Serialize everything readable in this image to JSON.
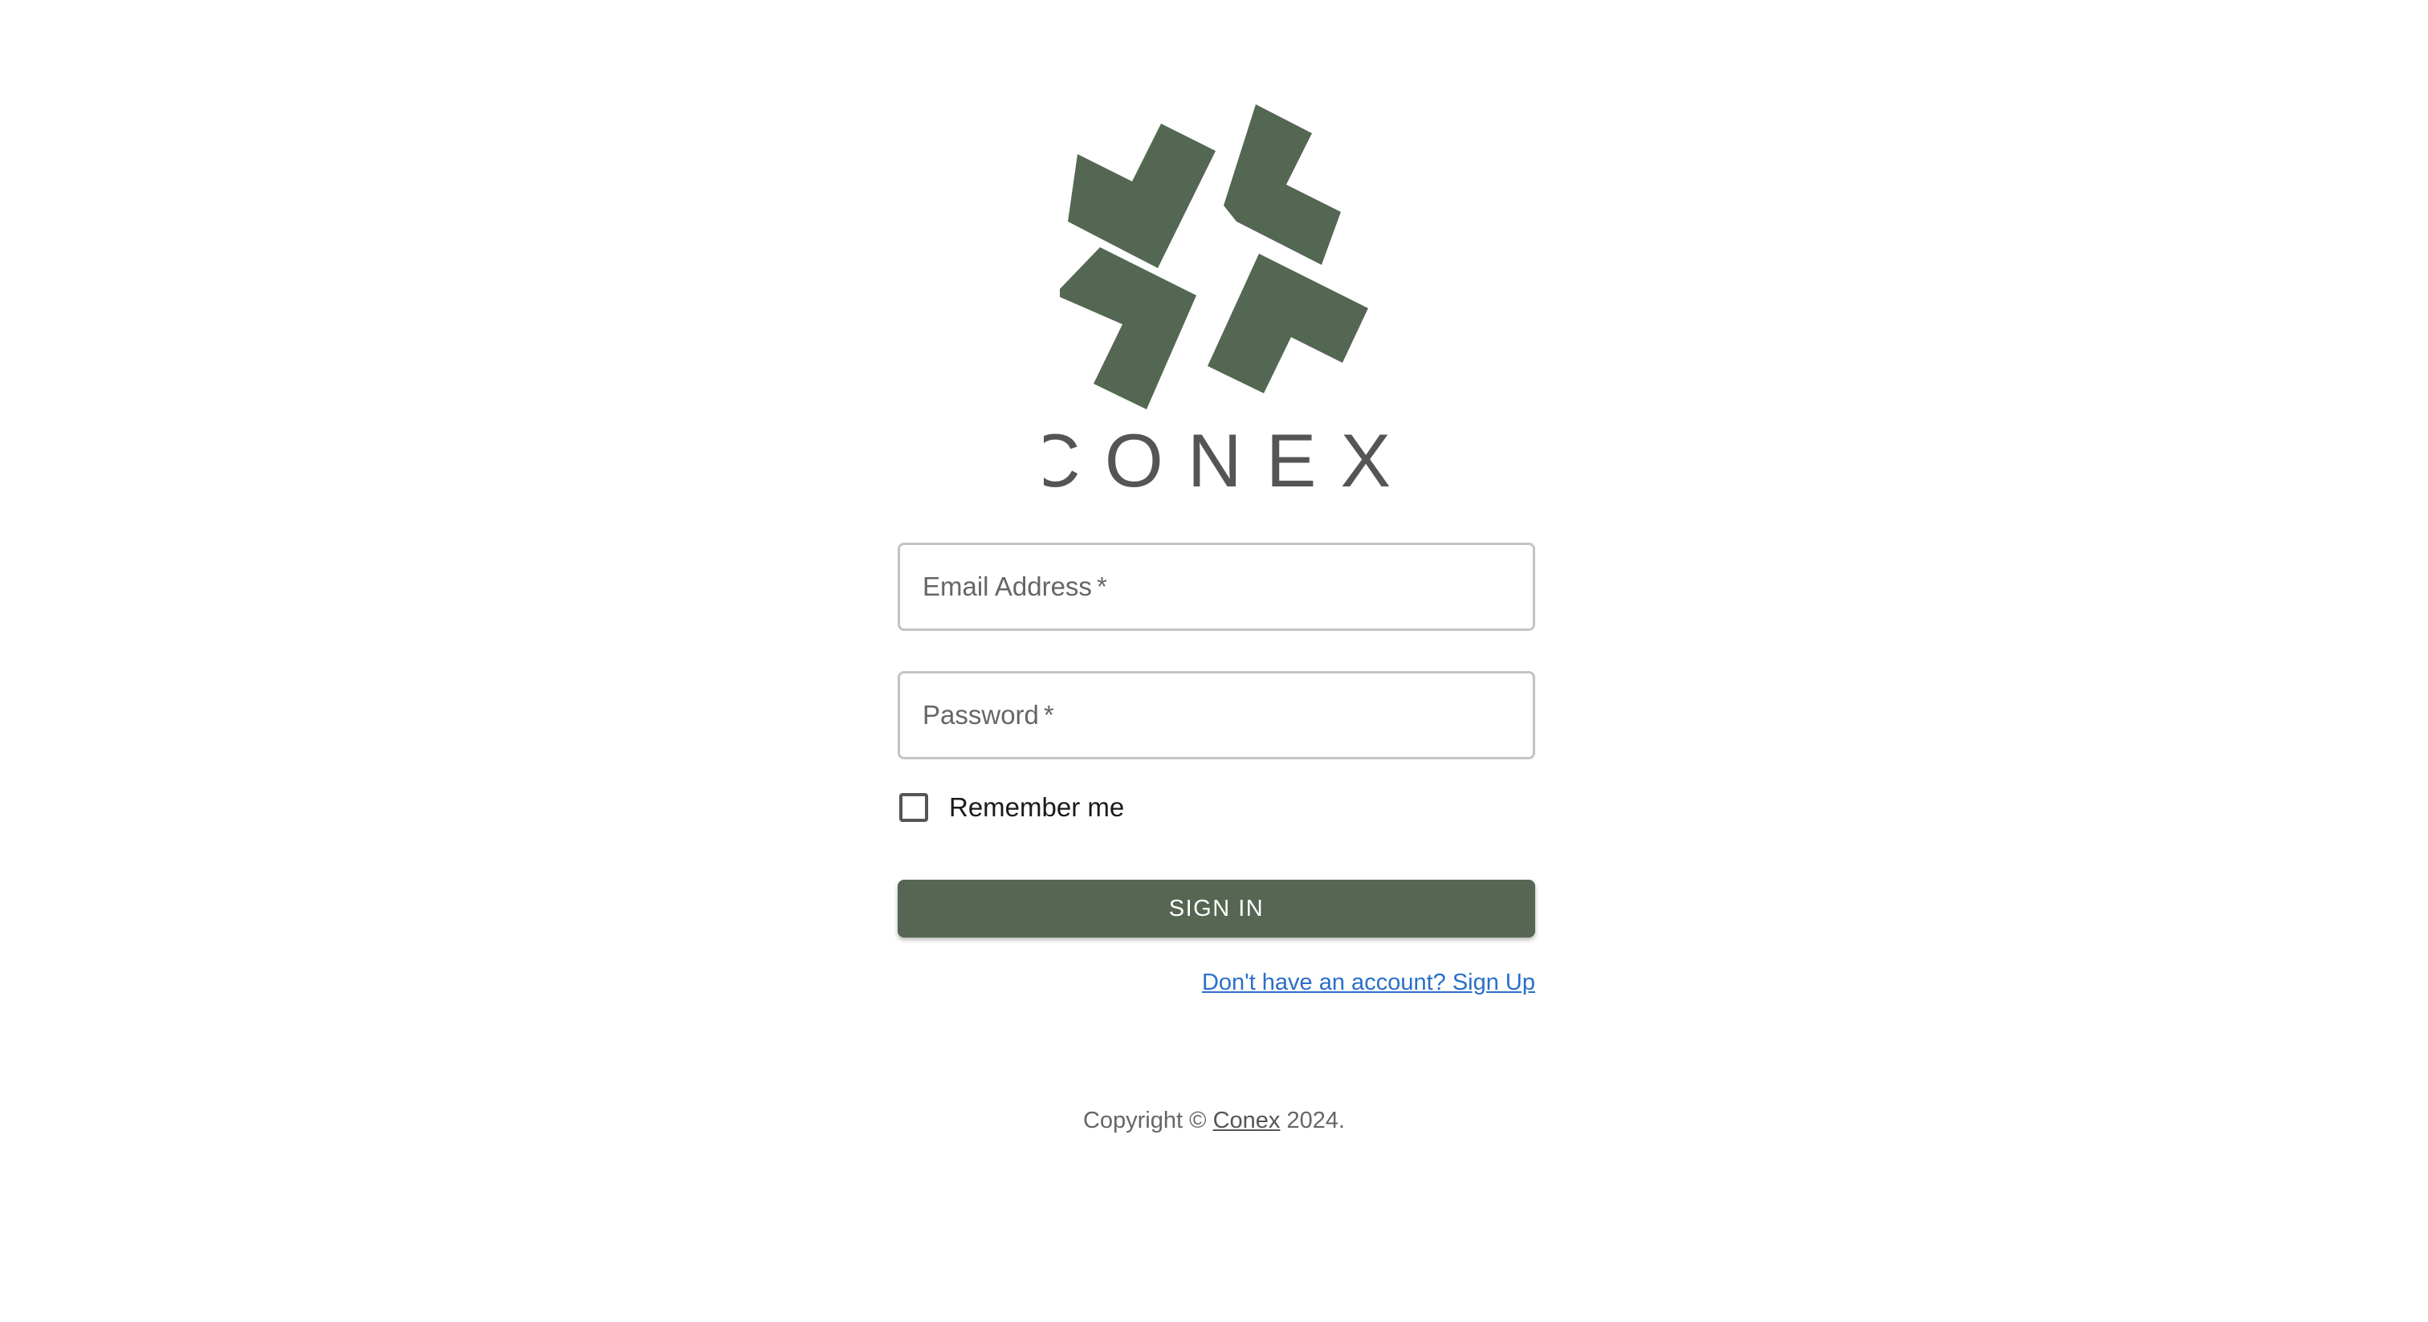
{
  "brand": {
    "logo_icon": "conex-logo-icon",
    "wordmark": "CONEX",
    "logo_color": "#546752",
    "wordmark_color": "#555555"
  },
  "form": {
    "email_label": "Email Address",
    "email_value": "",
    "password_label": "Password",
    "password_value": "",
    "required_marker": "*",
    "remember_label": "Remember me",
    "remember_checked": false,
    "submit_label": "SIGN IN",
    "submit_color": "#566653",
    "signup_link": "Don't have an account? Sign Up",
    "link_color": "#2a6fc9"
  },
  "footer": {
    "copyright_prefix": "Copyright ©",
    "brand_link": "Conex",
    "copyright_suffix": "2024."
  }
}
